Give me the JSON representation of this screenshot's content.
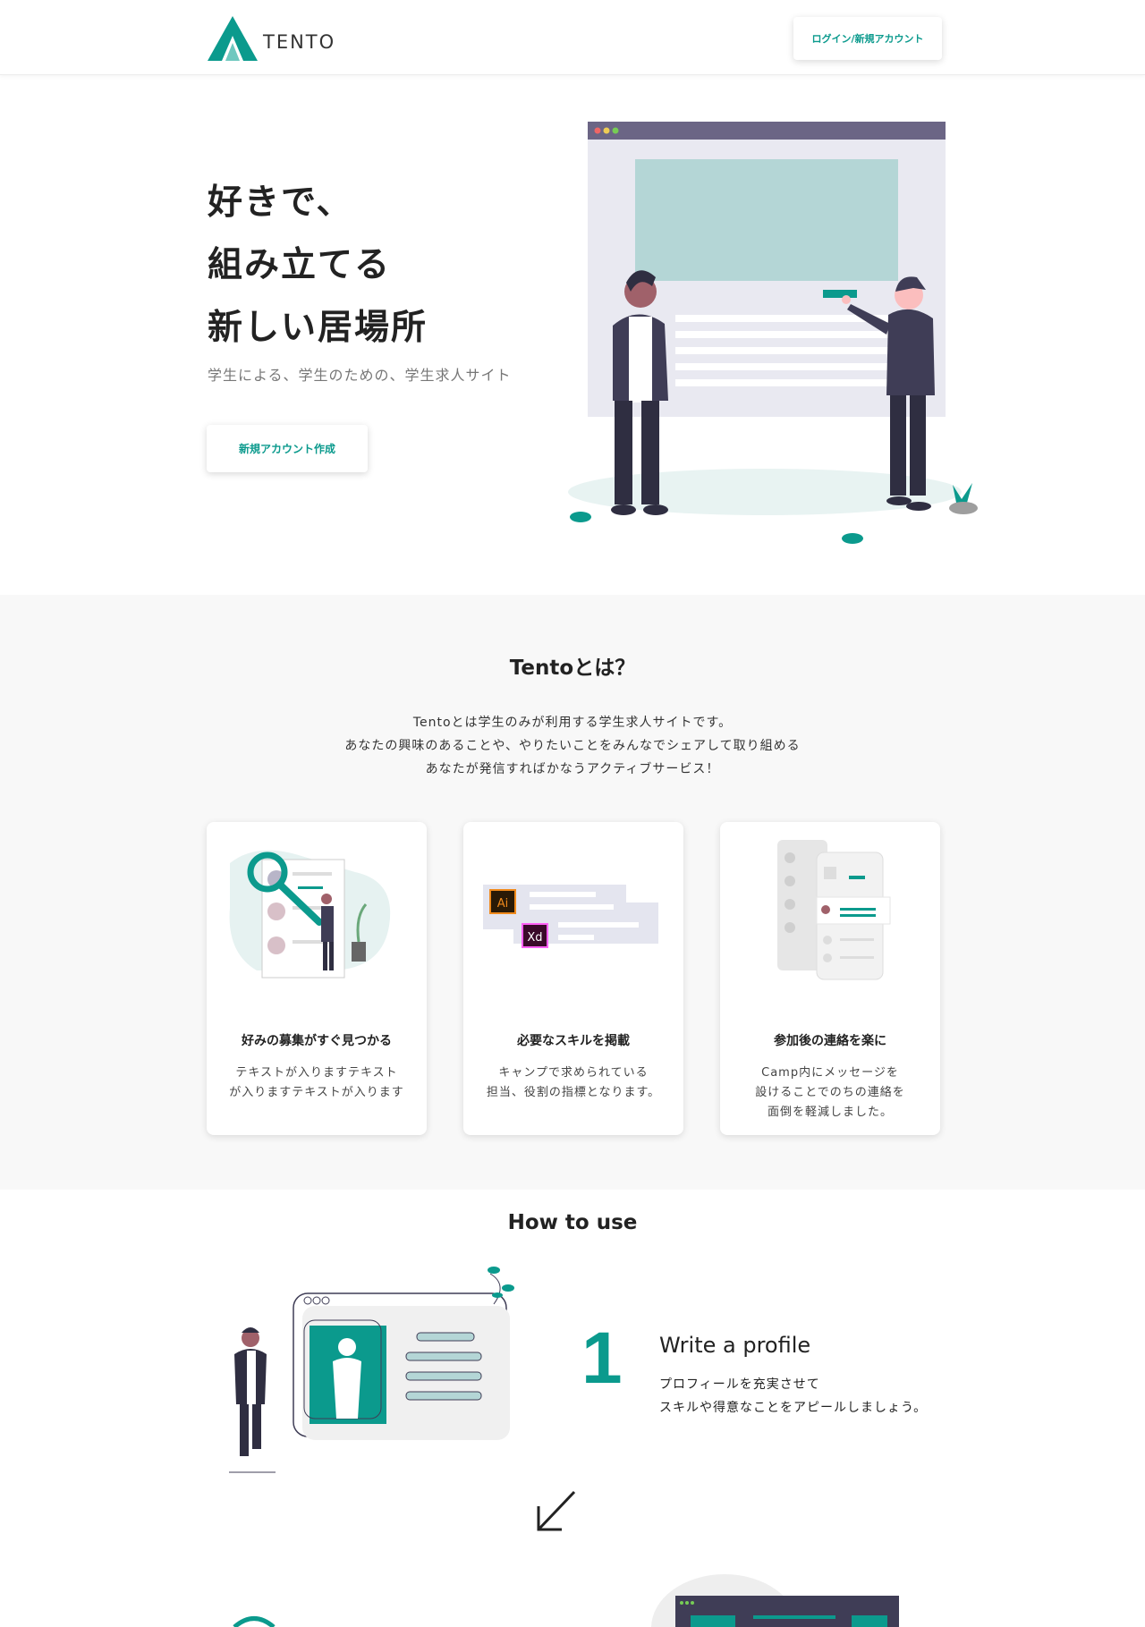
{
  "header": {
    "logo_text": "TENTO",
    "login_label": "ログイン/新規アカウント"
  },
  "hero": {
    "title_line1_highlight": "好き",
    "title_line1_rest": "で、",
    "title_line2": "組み立てる",
    "title_line3": "新しい居場所",
    "subtitle": "学生による、学生のための、学生求人サイト",
    "cta_label": "新規アカウント作成"
  },
  "about": {
    "title": "Tentoとは？",
    "description": [
      "Tentoとは学生のみが利用する学生求人サイトです。",
      "あなたの興味のあることや、やりたいことをみんなでシェアして取り組める",
      "あなたが発信すればかなうアクティブサービス！"
    ],
    "cards": [
      {
        "title": "好みの募集がすぐ見つかる",
        "text": "テキストが入りますテキスト\nが入りますテキストが入ります"
      },
      {
        "title": "必要なスキルを掲載",
        "text": "キャンプで求められている\n担当、役割の指標となります。"
      },
      {
        "title": "参加後の連絡を楽に",
        "text": "Camp内にメッセージを\n設けることでのちの連絡を\n面倒を軽減しました。"
      }
    ],
    "skill_badges": [
      "Ai",
      "Xd"
    ]
  },
  "how_to_use": {
    "title": "How to use",
    "steps": [
      {
        "number": "1",
        "title": "Write a profile",
        "text": "プロフィールを充実させて\nスキルや得意なことをアピールしましょう。"
      }
    ]
  },
  "colors": {
    "accent": "#0b9a8d",
    "accent_light": "#b4d6d6",
    "dark": "#3f3d56",
    "bg_soft": "#f8f8f8"
  }
}
